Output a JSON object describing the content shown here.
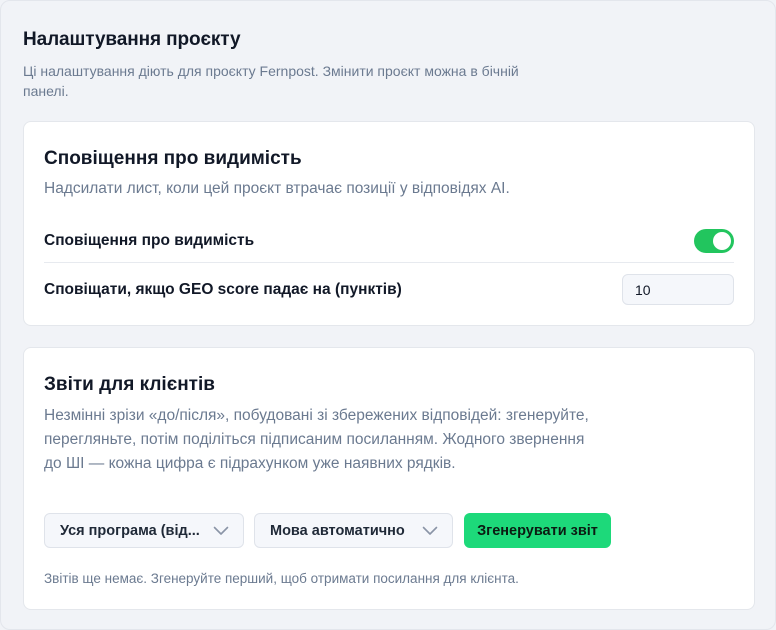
{
  "settings": {
    "title": "Налаштування проєкту",
    "description": "Ці налаштування діють для проєкту Fernpost. Змінити проєкт можна в бічній панелі."
  },
  "visibility": {
    "title": "Сповіщення про видимість",
    "description": "Надсилати лист, коли цей проєкт втрачає позиції у відповідях AI.",
    "toggle_label": "Сповіщення про видимість",
    "toggle_on": true,
    "threshold_label": "Сповіщати, якщо GEO score падає на (пунктів)",
    "threshold_value": "10"
  },
  "reports": {
    "title": "Звіти для клієнтів",
    "description": "Незмінні зрізи «до/після», побудовані зі збережених відповідей: згенеруйте, перегляньте, потім поділіться підписаним посиланням. Жодного звернення до ШІ — кожна цифра є підрахунком уже наявних рядків.",
    "program_select": "Уся програма (від...",
    "language_select": "Мова автоматично",
    "generate_label": "Згенерувати звіт",
    "empty_note": "Звітів ще немає. Згенеруйте перший, щоб отримати посилання для клієнта."
  },
  "icons": {
    "toggle": "toggle-switch-icon",
    "select_chevron": "chevron-down-icon"
  },
  "colors": {
    "accent_green": "#1dd97a",
    "toggle_green": "#22c55e",
    "muted_text": "#6b7a90"
  }
}
